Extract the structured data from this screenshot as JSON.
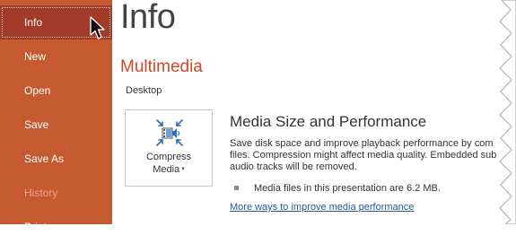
{
  "sidebar": {
    "items": [
      {
        "label": "Info"
      },
      {
        "label": "New"
      },
      {
        "label": "Open"
      },
      {
        "label": "Save"
      },
      {
        "label": "Save As"
      },
      {
        "label": "History"
      },
      {
        "label": "Print"
      }
    ]
  },
  "main": {
    "title": "Info",
    "section_heading": "Multimedia",
    "location": "Desktop",
    "compress_button": {
      "line1": "Compress",
      "line2": "Media",
      "dropdown_arrow": "▾"
    },
    "media_size": {
      "title": "Media Size and Performance",
      "description": [
        "Save disk space and improve playback performance by com",
        "files. Compression might affect media quality. Embedded sub",
        "audio tracks will be removed."
      ],
      "bullet": "Media files in this presentation are 6.2 MB.",
      "link": "More ways to improve media performance"
    }
  },
  "icons": {
    "compress": "compress-media-icon",
    "cursor": "mouse-pointer-icon",
    "bullet": "square-bullet-icon"
  },
  "colors": {
    "sidebar_bg": "#c55a30",
    "sidebar_active": "#a23b28",
    "accent": "#d24726",
    "link": "#2b579a",
    "icon_blue": "#2b6cb8"
  }
}
